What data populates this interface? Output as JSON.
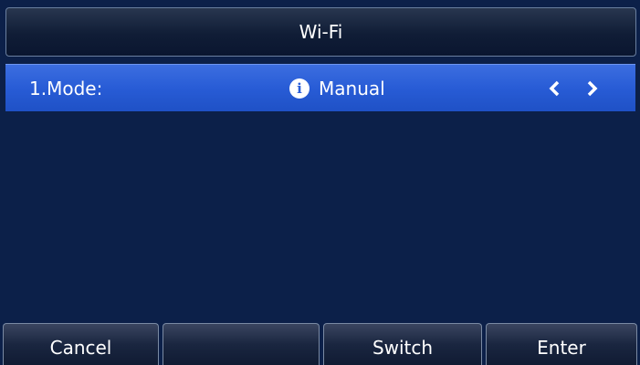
{
  "title": "Wi-Fi",
  "row": {
    "label": "1.Mode:",
    "value": "Manual",
    "info_icon": "info-icon",
    "prev_icon": "chevron-left-icon",
    "next_icon": "chevron-right-icon"
  },
  "softkeys": {
    "key1": "Cancel",
    "key2": "",
    "key3": "Switch",
    "key4": "Enter"
  },
  "colors": {
    "background": "#0c2049",
    "selected_row": "#285cd6",
    "text": "#ffffff"
  }
}
